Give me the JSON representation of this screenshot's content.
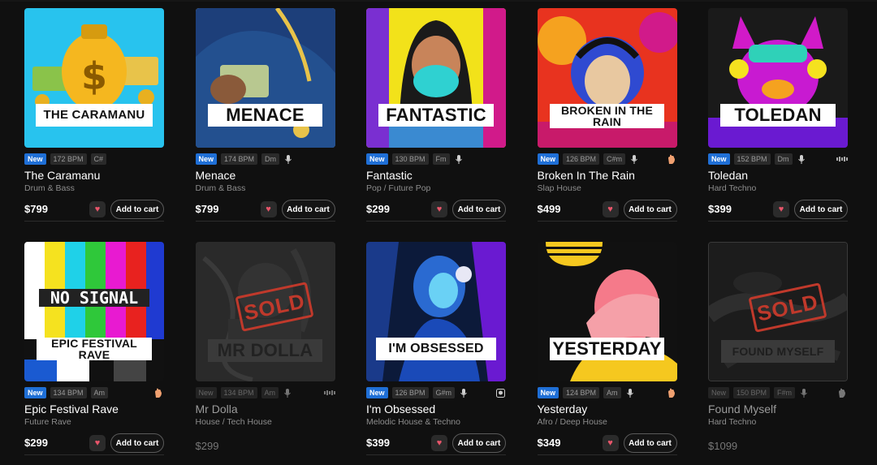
{
  "cart_label": "Add to cart",
  "sold_label": "SOLD",
  "cards": [
    {
      "art_title": "THE CARAMANU",
      "new": "New",
      "bpm": "172 BPM",
      "key": "C#",
      "vocals": false,
      "name": "The Caramanu",
      "genre": "Drum & Bass",
      "price": "$799",
      "sold": false
    },
    {
      "art_title": "MENACE",
      "new": "New",
      "bpm": "174 BPM",
      "key": "Dm",
      "vocals": true,
      "name": "Menace",
      "genre": "Drum & Bass",
      "price": "$799",
      "sold": false
    },
    {
      "art_title": "FANTASTIC",
      "new": "New",
      "bpm": "130 BPM",
      "key": "Fm",
      "vocals": true,
      "name": "Fantastic",
      "genre": "Pop / Future Pop",
      "price": "$299",
      "sold": false
    },
    {
      "art_title": "BROKEN IN THE RAIN",
      "new": "New",
      "bpm": "126 BPM",
      "key": "C#m",
      "vocals": true,
      "name": "Broken In The Rain",
      "genre": "Slap House",
      "price": "$499",
      "sold": false
    },
    {
      "art_title": "TOLEDAN",
      "new": "New",
      "bpm": "152 BPM",
      "key": "Dm",
      "vocals": true,
      "name": "Toledan",
      "genre": "Hard Techno",
      "price": "$399",
      "sold": false
    },
    {
      "art_title": "EPIC FESTIVAL RAVE",
      "art_extra": "NO SIGNAL",
      "new": "New",
      "bpm": "134 BPM",
      "key": "Am",
      "vocals": false,
      "name": "Epic Festival Rave",
      "genre": "Future Rave",
      "price": "$299",
      "sold": false
    },
    {
      "art_title": "MR DOLLA",
      "new": "New",
      "bpm": "134 BPM",
      "key": "Am",
      "vocals": true,
      "name": "Mr Dolla",
      "genre": "House / Tech House",
      "price": "$299",
      "sold": true
    },
    {
      "art_title": "I'M OBSESSED",
      "new": "New",
      "bpm": "126 BPM",
      "key": "G#m",
      "vocals": true,
      "name": "I'm Obsessed",
      "genre": "Melodic House & Techno",
      "price": "$399",
      "sold": false
    },
    {
      "art_title": "YESTERDAY",
      "new": "New",
      "bpm": "124 BPM",
      "key": "Am",
      "vocals": true,
      "name": "Yesterday",
      "genre": "Afro / Deep House",
      "price": "$349",
      "sold": false
    },
    {
      "art_title": "FOUND MYSELF",
      "new": "New",
      "bpm": "150 BPM",
      "key": "F#m",
      "vocals": true,
      "name": "Found Myself",
      "genre": "Hard Techno",
      "price": "$1099",
      "sold": true
    }
  ],
  "icons": {
    "mic": "microphone-icon",
    "heart": "heart-icon",
    "hand": "hand-icon",
    "stems": "stems-icon",
    "rating": "explicit-icon"
  },
  "colors": {
    "background": "#101010",
    "new_badge": "#1f6fd6",
    "heart": "#e8556a",
    "sold": "#c0392b"
  }
}
